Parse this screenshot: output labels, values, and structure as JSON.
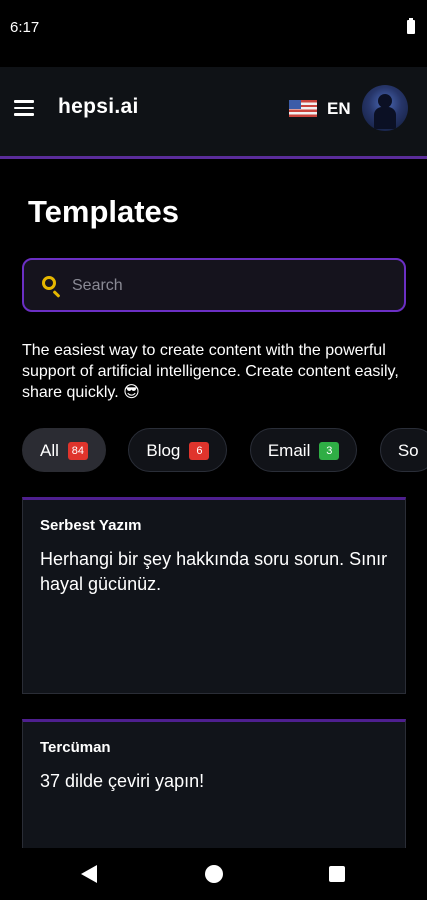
{
  "status_bar": {
    "time": "6:17"
  },
  "header": {
    "brand": "hepsi.ai",
    "language": "EN"
  },
  "page": {
    "title": "Templates",
    "search_placeholder": "Search",
    "intro": "The easiest way to create content with the powerful support of artificial intelligence. Create content easily, share quickly. 😎"
  },
  "filters": [
    {
      "label": "All",
      "count": "84",
      "badge_color": "#e0342c"
    },
    {
      "label": "Blog",
      "count": "6",
      "badge_color": "#e0342c"
    },
    {
      "label": "Email",
      "count": "3",
      "badge_color": "#2fae45"
    },
    {
      "label": "So",
      "count": "",
      "badge_color": ""
    }
  ],
  "cards": [
    {
      "title": "Serbest Yazım",
      "description": "Herhangi bir şey hakkında soru sorun. Sınır hayal gücünüz."
    },
    {
      "title": "Tercüman",
      "description": "37 dilde çeviri yapın!"
    }
  ],
  "colors": {
    "accent": "#6b2fc4",
    "search_icon": "#e6b700",
    "background": "#000000",
    "card": "#11141a"
  }
}
